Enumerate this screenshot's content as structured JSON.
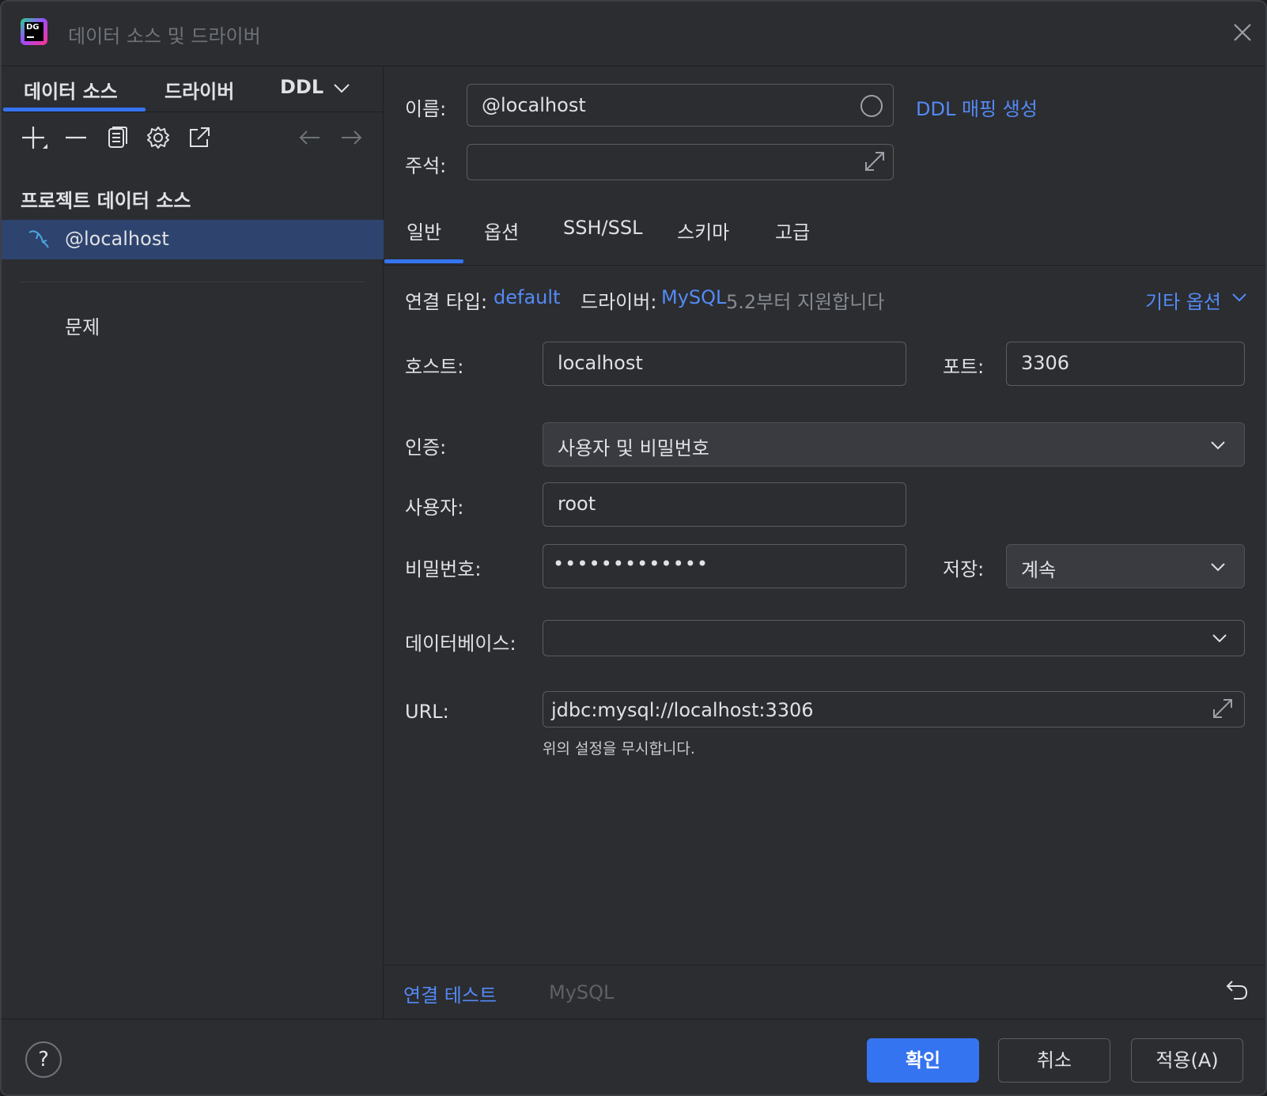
{
  "window": {
    "title": "데이터 소스 및 드라이버",
    "app_icon_text": "DG"
  },
  "left": {
    "tabs": [
      "데이터 소스",
      "드라이버",
      "DDL"
    ],
    "section_title": "프로젝트 데이터 소스",
    "datasource": "@localhost",
    "problems": "문제"
  },
  "form": {
    "name_label": "이름:",
    "name_value": "@localhost",
    "ddl_link": "DDL 매핑 생성",
    "comment_label": "주석:",
    "tabs": [
      "일반",
      "옵션",
      "SSH/SSL",
      "스키마",
      "고급"
    ],
    "conn_type_label": "연결 타입:",
    "conn_type_value": "default",
    "driver_label": "드라이버:",
    "driver_value": "MySQL",
    "driver_note": "5.2부터 지원합니다",
    "more_options": "기타 옵션",
    "host_label": "호스트:",
    "host_value": "localhost",
    "port_label": "포트:",
    "port_value": "3306",
    "auth_label": "인증:",
    "auth_value": "사용자 및 비밀번호",
    "user_label": "사용자:",
    "user_value": "root",
    "password_label": "비밀번호:",
    "password_value": "•••••••••••••",
    "save_label": "저장:",
    "save_value": "계속",
    "database_label": "데이터베이스:",
    "url_label": "URL:",
    "url_value": "jdbc:mysql://localhost:3306",
    "url_note": "위의 설정을 무시합니다.",
    "test_connection": "연결 테스트",
    "footer_driver": "MySQL"
  },
  "footer": {
    "help": "?",
    "ok": "확인",
    "cancel": "취소",
    "apply": "적용(A)"
  },
  "colors": {
    "accent": "#3574f0",
    "link": "#548af7",
    "selection": "#2e436e",
    "background": "#2b2d30"
  }
}
